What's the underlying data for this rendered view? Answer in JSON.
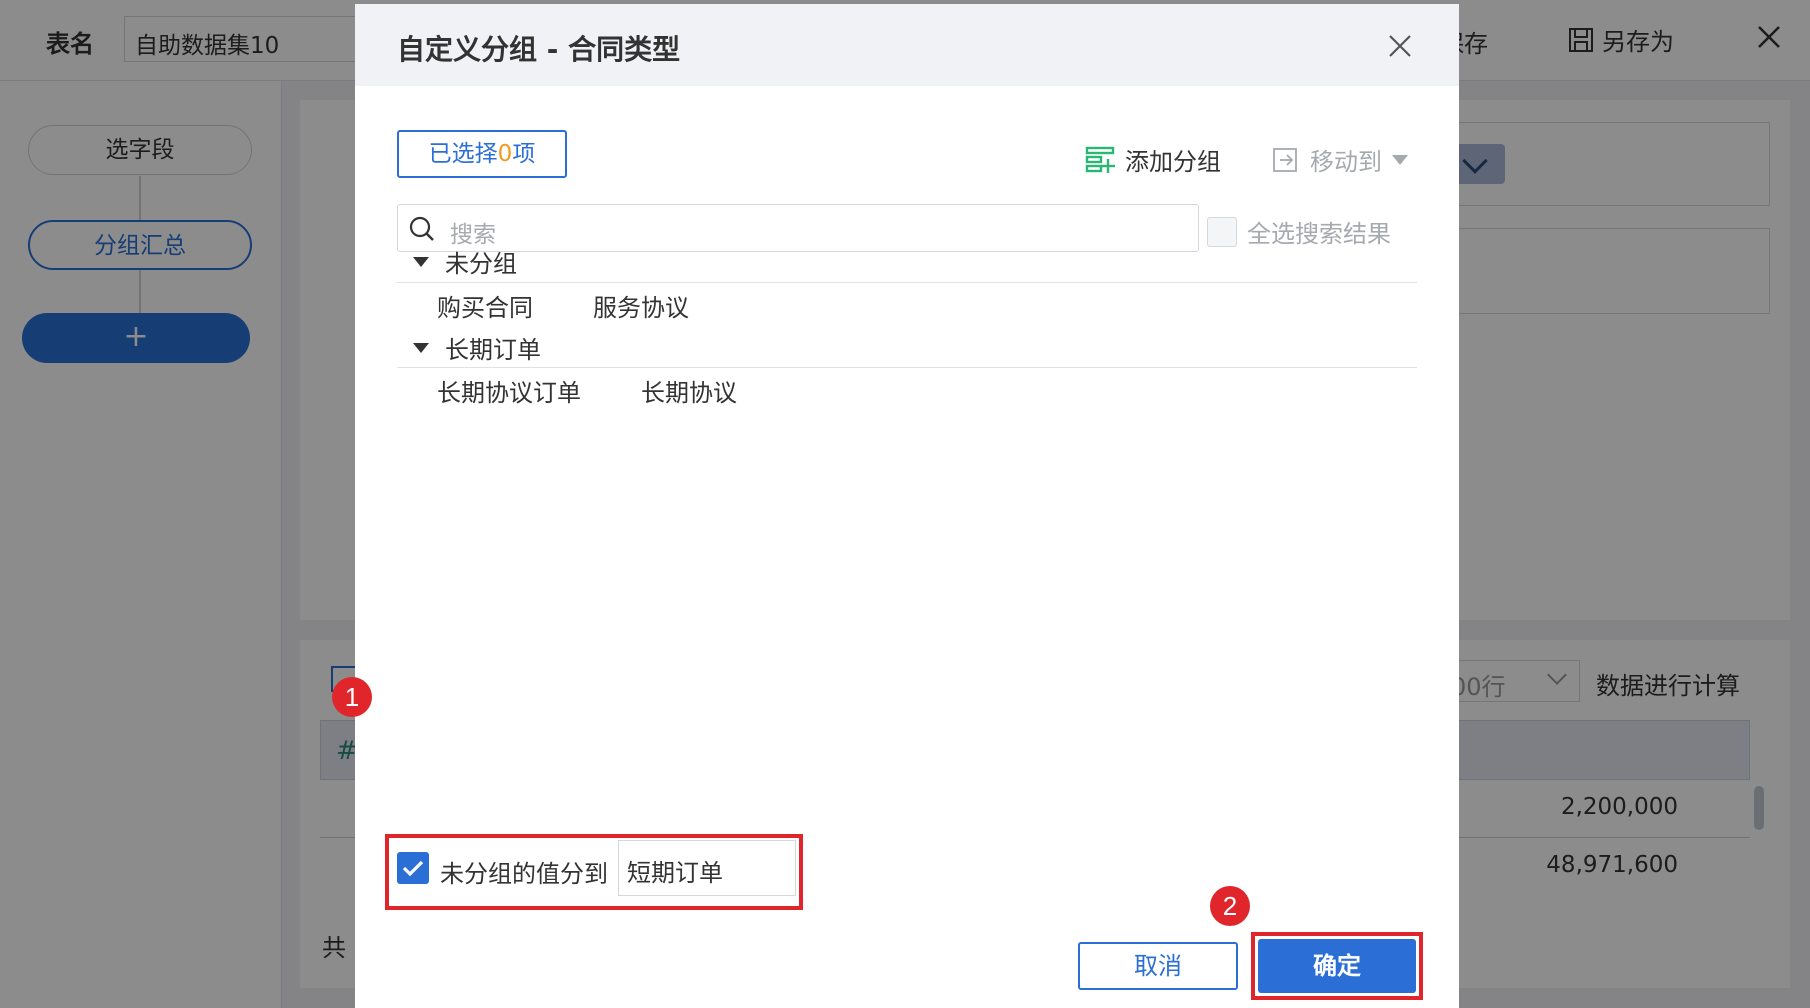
{
  "topbar": {
    "table_name_label": "表名",
    "table_name_value": "自助数据集10",
    "save_label": "保存",
    "save_as_label": "另存为"
  },
  "left_panel": {
    "steps": [
      {
        "label": "选字段"
      },
      {
        "label": "分组汇总"
      }
    ],
    "add_label": "+"
  },
  "main": {
    "rows_select_value": "00行",
    "calc_label": "数据进行计算",
    "table_rows": [
      {
        "value": "2,200,000"
      },
      {
        "value": "48,971,600"
      }
    ],
    "total_label": "共",
    "hash_symbol": "#"
  },
  "dialog": {
    "title": "自定义分组 - 合同类型",
    "selected_prefix": "已选择",
    "selected_count": "0",
    "selected_suffix": "项",
    "add_group_label": "添加分组",
    "move_to_label": "移动到",
    "search_placeholder": "搜索",
    "select_all_results_label": "全选搜索结果",
    "groups": [
      {
        "name": "未分组",
        "items": [
          "购买合同",
          "服务协议"
        ]
      },
      {
        "name": "长期订单",
        "items": [
          "长期协议订单",
          "长期协议"
        ]
      }
    ],
    "ungrouped_to_label": "未分组的值分到",
    "ungrouped_to_value": "短期订单",
    "ungrouped_checked": true,
    "cancel_label": "取消",
    "ok_label": "确定"
  },
  "annotations": {
    "badge_1": "1",
    "badge_2": "2"
  },
  "colors": {
    "accent": "#2b6fd6",
    "callout_red": "#e0262b",
    "count_orange": "#f39b1b",
    "add_group_green": "#2bb673"
  }
}
